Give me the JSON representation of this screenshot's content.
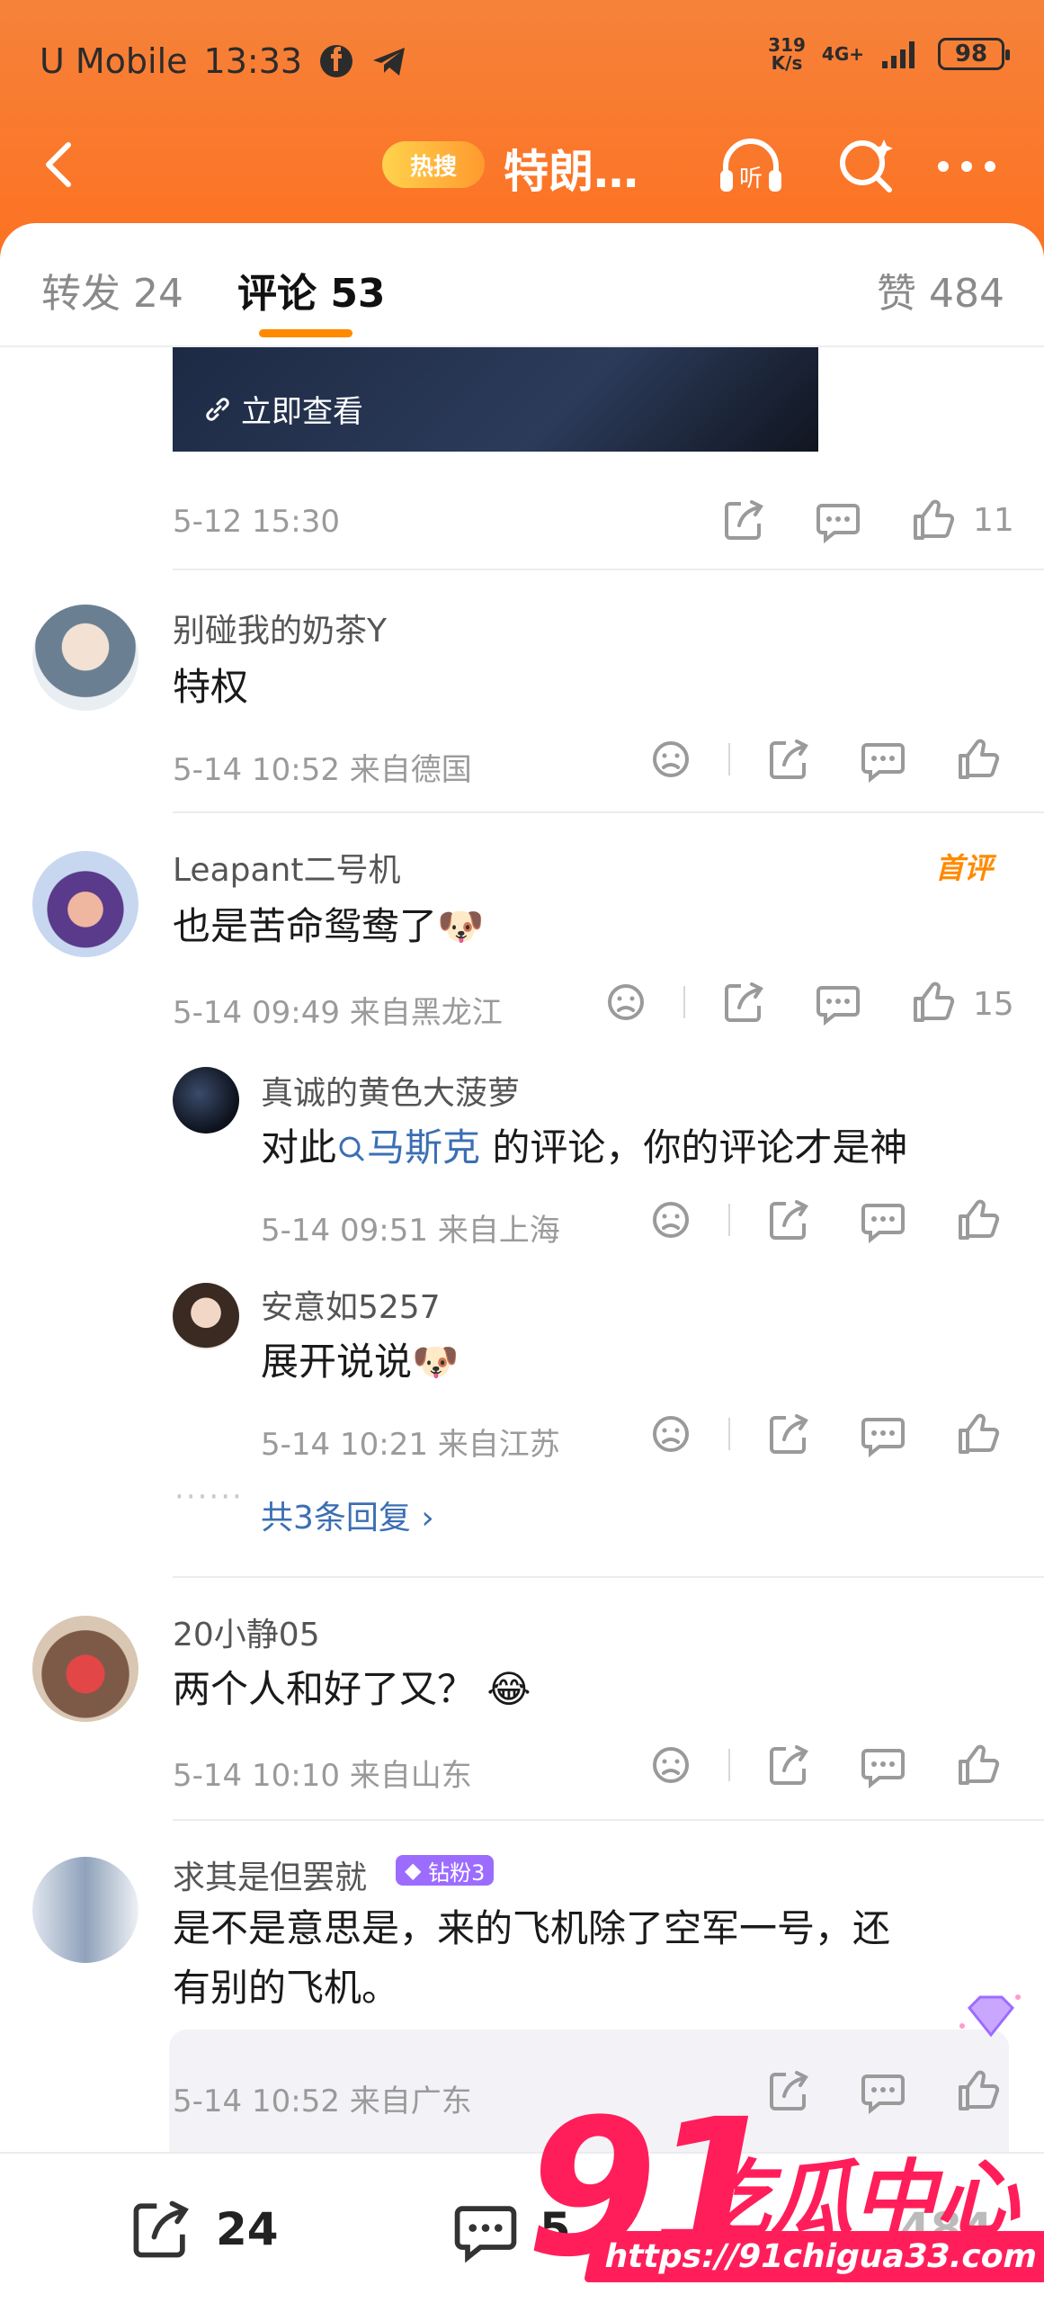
{
  "status_bar": {
    "carrier": "U Mobile",
    "time": "13:33",
    "speed_top": "319",
    "speed_bottom": "K/s",
    "network": "4G+",
    "battery": "98"
  },
  "nav": {
    "hot_label": "热搜",
    "title": "特朗…",
    "listen_label": "听"
  },
  "tabs": {
    "repost": "转发 24",
    "comments": "评论 53",
    "likes": "赞 484"
  },
  "top_post": {
    "media_link": "立即查看",
    "time": "5-12 15:30",
    "like_count": "11"
  },
  "comments": [
    {
      "user": "别碰我的奶茶Y",
      "text": "特权",
      "meta": "5-14 10:52  来自德国",
      "like_count": ""
    },
    {
      "user": "Leapant二号机",
      "text": "也是苦命鸳鸯了🐶",
      "meta": "5-14 09:49  来自黑龙江",
      "like_count": "15",
      "badge": "首评",
      "replies": [
        {
          "user": "真诚的黄色大菠萝",
          "text_pre": "对此",
          "text_link": "马斯克",
          "text_post": " 的评论，你的评论才是神",
          "meta": "5-14 09:51  来自上海"
        },
        {
          "user": "安意如5257",
          "text": "展开说说🐶",
          "meta": "5-14 10:21  来自江苏"
        }
      ],
      "more_replies": "共3条回复 ›"
    },
    {
      "user": "20小静05",
      "text": "两个人和好了又？ 😂",
      "meta": "5-14 10:10  来自山东",
      "like_count": ""
    },
    {
      "user": "求其是但罢就",
      "badge": "钻粉3",
      "text_line1": "是不是意思是，来的飞机除了空军一号，还",
      "text_line2": "有别的飞机。",
      "meta": "5-14 10:52  来自广东",
      "like_count": ""
    }
  ],
  "bottom_bar": {
    "repost_count": "24",
    "comment_count": "5",
    "like_count": "484"
  },
  "watermark": {
    "number": "91",
    "name": "吃瓜中心",
    "url": "https://91chigua33.com"
  },
  "colors": {
    "accent": "#ff8a00",
    "topbar": "#f5823a",
    "link": "#3b6fb3",
    "watermark": "#ff1e5a"
  }
}
